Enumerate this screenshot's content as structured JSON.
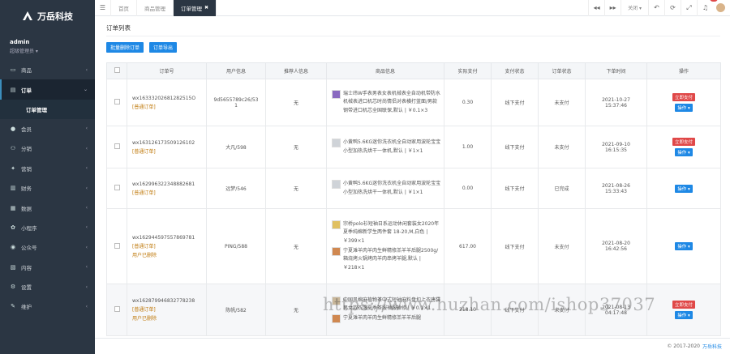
{
  "brand": {
    "name": "万岳科技"
  },
  "user": {
    "name": "admin",
    "role": "超级管理员 ▾"
  },
  "menu": [
    {
      "icon": "▭",
      "label": "商品",
      "active": false
    },
    {
      "icon": "▤",
      "label": "订单",
      "active": true
    },
    {
      "icon": "●",
      "label": "会员",
      "active": false
    },
    {
      "icon": "⚇",
      "label": "分销",
      "active": false
    },
    {
      "icon": "✦",
      "label": "营销",
      "active": false
    },
    {
      "icon": "▥",
      "label": "财务",
      "active": false
    },
    {
      "icon": "▦",
      "label": "数据",
      "active": false
    },
    {
      "icon": "✿",
      "label": "小程序",
      "active": false
    },
    {
      "icon": "◉",
      "label": "公众号",
      "active": false
    },
    {
      "icon": "▧",
      "label": "内容",
      "active": false
    },
    {
      "icon": "⚙",
      "label": "设置",
      "active": false
    },
    {
      "icon": "✎",
      "label": "维护",
      "active": false
    }
  ],
  "submenu": {
    "label": "订单管理"
  },
  "tabs": [
    {
      "label": "首页",
      "active": false
    },
    {
      "label": "商品管理",
      "active": false
    },
    {
      "label": "订单管理",
      "active": true
    }
  ],
  "topbar": {
    "close_label": "关闭 ▾",
    "notif_count": "20"
  },
  "page": {
    "title": "订单列表",
    "btn_batch_delete": "批量删除订单",
    "btn_export": "订单导出"
  },
  "table": {
    "headers": [
      "",
      "订单号",
      "用户信息",
      "推荐人信息",
      "商品信息",
      "实际支付",
      "支付状态",
      "订单状态",
      "下单时间",
      "操作"
    ],
    "rows": [
      {
        "order_no": "wx16333202681282515O",
        "type": "[普通订单]",
        "extra": "",
        "user": "9d5655789c26/53",
        "user2": "1",
        "referrer": "无",
        "goods": [
          {
            "thumb": "t1",
            "text": "瑞士纬W手表男表女表机械表全自动机带防水机械表进口机芯时尚情侣对表横打蓝面/男款钢带进口机芯全国联保,默认 | ￥0.1×3"
          }
        ],
        "paid": "0.30",
        "pay_status": "线下支付",
        "order_status": "未支付",
        "time": "2021-10-27",
        "time2": "15:37:46",
        "pay_btn": "立即支付",
        "op_btn": "操作 ▾"
      },
      {
        "order_no": "wx163126173509126102",
        "type": "[普通订单]",
        "extra": "",
        "user": "大凡/598",
        "user2": "",
        "referrer": "无",
        "goods": [
          {
            "thumb": "t2",
            "text": "小黄鸭5.6KG迷你洗衣机全自动家用波轮宝宝小型加热洗烘干一体机,默认 | ￥1×1"
          }
        ],
        "paid": "1.00",
        "pay_status": "线下支付",
        "order_status": "未支付",
        "time": "2021-09-10",
        "time2": "16:15:35",
        "pay_btn": "立即支付",
        "op_btn": "操作 ▾"
      },
      {
        "order_no": "wx162996322348882681",
        "type": "[普通订单]",
        "extra": "",
        "user": "远梦/546",
        "user2": "",
        "referrer": "无",
        "goods": [
          {
            "thumb": "t2",
            "text": "小黄鸭5.6KG迷你洗衣机全自动家用波轮宝宝小型加热洗烘干一体机,默认 | ￥1×1"
          }
        ],
        "paid": "0.00",
        "pay_status": "线下支付",
        "order_status": "已完成",
        "time": "2021-08-26",
        "time2": "15:33:43",
        "pay_btn": "",
        "op_btn": "操作 ▾"
      },
      {
        "order_no": "wx162944597557869781",
        "type": "[普通订单]",
        "extra": "用户已删除",
        "user": "PING/588",
        "user2": "",
        "referrer": "无",
        "goods": [
          {
            "thumb": "t3",
            "text": "宗桥polo衫短袖日系运动休闲套装女2020年夏季纯棉新学生两件套 18-20,M,白色 | ￥399×1"
          },
          {
            "thumb": "t4",
            "text": "宁夏滩羊肉羊肉生鲜精修羔羊羊后腿2500g/箱烧烤火锅烤肉羊肉串烤羊腿,默认 | ￥218×1"
          }
        ],
        "paid": "617.00",
        "pay_status": "线下支付",
        "order_status": "未支付",
        "time": "2021-08-20",
        "time2": "16:42:56",
        "pay_btn": "",
        "op_btn": "操作 ▾"
      },
      {
        "order_no": "wx162879946832778238",
        "type": "[普通订单]",
        "extra": "用户已删除",
        "user": "陈帆/582",
        "user2": "",
        "referrer": "无",
        "goods": [
          {
            "thumb": "t5",
            "text": "中国风棉麻植物茶中式短袖麻料盘扣上衣唐装男女款衣服夏季茶服禅服禅修 | ￥0.1×1"
          },
          {
            "thumb": "t4",
            "text": "宁夏滩羊肉羊肉生鲜精修羔羊羊后腿"
          }
        ],
        "paid": "218.10",
        "pay_status": "线下支付",
        "order_status": "未支付",
        "time": "2021-08-13",
        "time2": "04:17:48",
        "pay_btn": "立即支付",
        "op_btn": "操作 ▾"
      }
    ]
  },
  "footer": {
    "copyright": "© 2017-2020",
    "brand": "万岳科技"
  },
  "watermark": "https://www.huzhan.com/ishop37037"
}
